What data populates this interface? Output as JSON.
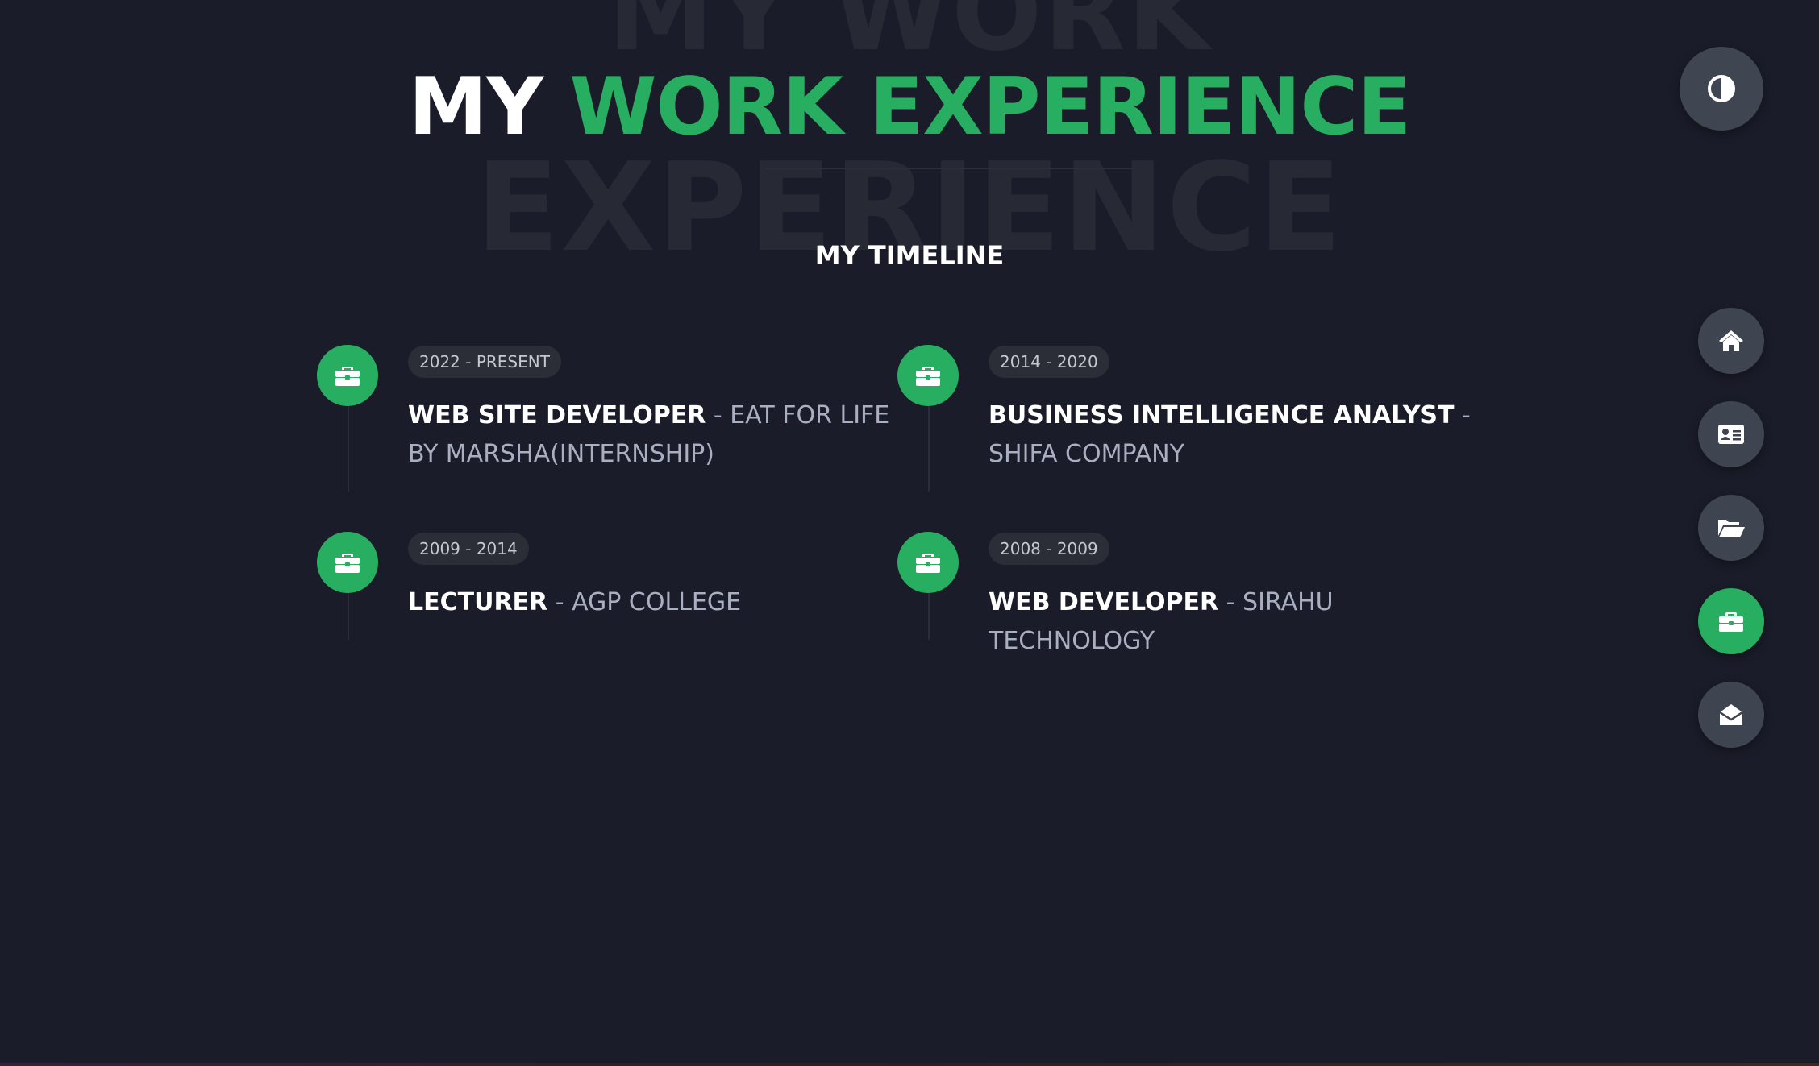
{
  "header": {
    "watermark_line1": "MY WORK",
    "watermark_line2": "EXPERIENCE",
    "title_white": "MY",
    "title_green": "WORK EXPERIENCE",
    "subtitle": "MY TIMELINE"
  },
  "timeline": [
    {
      "period": "2022 - PRESENT",
      "role": "WEB SITE DEVELOPER",
      "separator": " - ",
      "company": "EAT FOR LIFE BY MARSHA(INTERNSHIP)",
      "icon": "briefcase-icon"
    },
    {
      "period": "2014 - 2020",
      "role": "BUSINESS INTELLIGENCE ANALYST",
      "separator": " - ",
      "company": "SHIFA COMPANY",
      "icon": "briefcase-icon"
    },
    {
      "period": "2009 - 2014",
      "role": "LECTURER",
      "separator": " - ",
      "company": "AGP COLLEGE",
      "icon": "briefcase-icon"
    },
    {
      "period": "2008 - 2009",
      "role": "WEB DEVELOPER",
      "separator": " - ",
      "company": "SIRAHU TECHNOLOGY",
      "icon": "briefcase-icon"
    }
  ],
  "controls": {
    "theme_toggle_icon": "contrast-icon",
    "nav": [
      {
        "icon": "home-icon",
        "active": false
      },
      {
        "icon": "id-card-icon",
        "active": false
      },
      {
        "icon": "folder-open-icon",
        "active": false
      },
      {
        "icon": "briefcase-icon",
        "active": true
      },
      {
        "icon": "envelope-open-icon",
        "active": false
      }
    ]
  },
  "colors": {
    "background": "#1a1c29",
    "accent": "#27ae60",
    "button": "#3f4451",
    "muted_text": "#a9aec0"
  }
}
